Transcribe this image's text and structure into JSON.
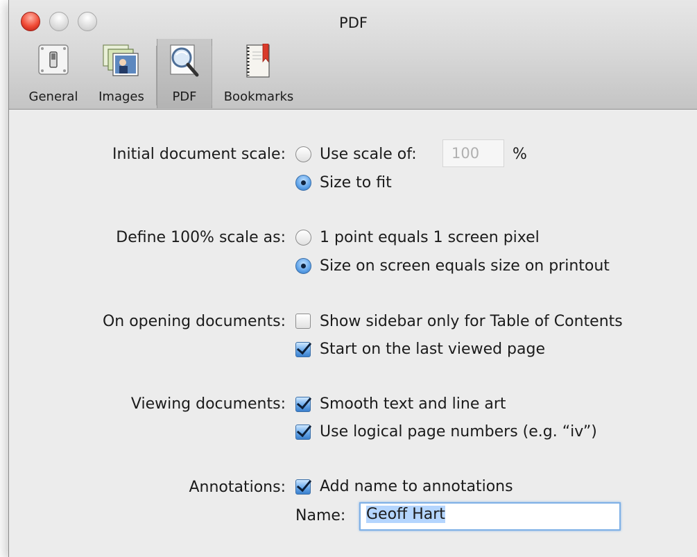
{
  "window": {
    "title": "PDF"
  },
  "toolbar": {
    "items": [
      {
        "label": "General",
        "icon": "general-switch-icon"
      },
      {
        "label": "Images",
        "icon": "images-stack-icon"
      },
      {
        "label": "PDF",
        "icon": "pdf-magnifier-icon",
        "selected": true
      },
      {
        "label": "Bookmarks",
        "icon": "bookmarks-book-icon"
      }
    ]
  },
  "settings": {
    "scale": {
      "label": "Initial document scale:",
      "use_scale_label": "Use scale of:",
      "scale_value": "100",
      "percent": "%",
      "size_to_fit_label": "Size to fit",
      "selected": "size_to_fit"
    },
    "define_scale": {
      "label": "Define 100% scale as:",
      "option1": "1 point equals 1 screen pixel",
      "option2": "Size on screen equals size on printout",
      "selected": "option2"
    },
    "opening": {
      "label": "On opening documents:",
      "sidebar_label": "Show sidebar only for Table of Contents",
      "sidebar_checked": false,
      "last_page_label": "Start on the last viewed page",
      "last_page_checked": true
    },
    "viewing": {
      "label": "Viewing documents:",
      "smooth_label": "Smooth text and line art",
      "smooth_checked": true,
      "logical_label": "Use logical page numbers (e.g. “iv”)",
      "logical_checked": true
    },
    "annotations": {
      "label": "Annotations:",
      "add_name_label": "Add name to annotations",
      "add_name_checked": true,
      "name_label": "Name:",
      "name_value": "Geoff Hart"
    }
  },
  "colors": {
    "accent": "#3a7fcc",
    "focus_ring": "#7eb0e6",
    "close_button": "#f04b36"
  }
}
